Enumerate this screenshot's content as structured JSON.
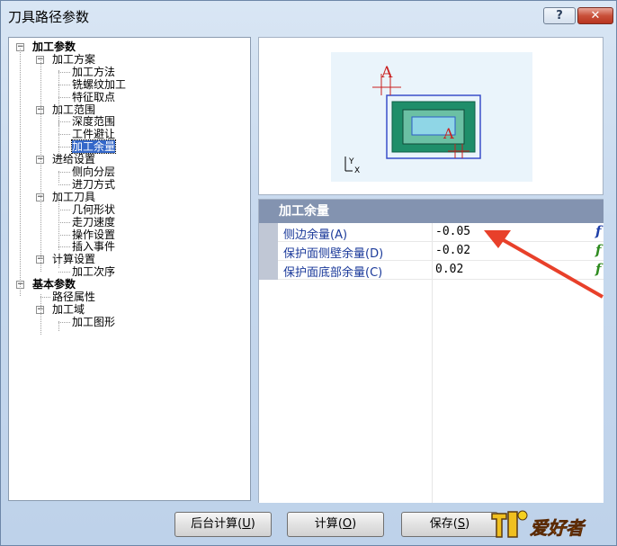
{
  "window": {
    "title": "刀具路径参数"
  },
  "titlebar": {
    "help_label": "?",
    "close_label": "✕"
  },
  "tree": {
    "items": [
      {
        "label": "加工参数",
        "bold": true,
        "selected": false
      },
      {
        "label": "加工方案",
        "bold": false,
        "selected": false
      },
      {
        "label": "加工方法",
        "bold": false,
        "selected": false
      },
      {
        "label": "铣螺纹加工",
        "bold": false,
        "selected": false
      },
      {
        "label": "特征取点",
        "bold": false,
        "selected": false
      },
      {
        "label": "加工范围",
        "bold": false,
        "selected": false
      },
      {
        "label": "深度范围",
        "bold": false,
        "selected": false
      },
      {
        "label": "工件避让",
        "bold": false,
        "selected": false
      },
      {
        "label": "加工余量",
        "bold": false,
        "selected": true
      },
      {
        "label": "进给设置",
        "bold": false,
        "selected": false
      },
      {
        "label": "侧向分层",
        "bold": false,
        "selected": false
      },
      {
        "label": "进刀方式",
        "bold": false,
        "selected": false
      },
      {
        "label": "加工刀具",
        "bold": false,
        "selected": false
      },
      {
        "label": "几何形状",
        "bold": false,
        "selected": false
      },
      {
        "label": "走刀速度",
        "bold": false,
        "selected": false
      },
      {
        "label": "操作设置",
        "bold": false,
        "selected": false
      },
      {
        "label": "插入事件",
        "bold": false,
        "selected": false
      },
      {
        "label": "计算设置",
        "bold": false,
        "selected": false
      },
      {
        "label": "加工次序",
        "bold": false,
        "selected": false
      },
      {
        "label": "基本参数",
        "bold": true,
        "selected": false
      },
      {
        "label": "路径属性",
        "bold": false,
        "selected": false
      },
      {
        "label": "加工域",
        "bold": false,
        "selected": false
      },
      {
        "label": "加工图形",
        "bold": false,
        "selected": false
      }
    ],
    "expand_symbol": "−"
  },
  "preview": {
    "label_top": "A",
    "label_inner": "A",
    "axis_y": "Y",
    "axis_x": "X"
  },
  "props": {
    "header": "加工余量",
    "rows": [
      {
        "name": "侧边余量(A)",
        "value": "-0.05",
        "fx": "f",
        "fx_color": "#1f3fa8"
      },
      {
        "name": "保护面侧壁余量(D)",
        "value": "-0.02",
        "fx": "f",
        "fx_color": "#2e8b1f"
      },
      {
        "name": "保护面底部余量(C)",
        "value": "0.02",
        "fx": "f",
        "fx_color": "#2e8b1f"
      }
    ]
  },
  "buttons": {
    "background_calc": {
      "text": "后台计算",
      "key": "U"
    },
    "calc": {
      "text": "计算",
      "key": "O"
    },
    "save": {
      "text": "保存",
      "key": "S"
    }
  },
  "watermark": {
    "text": "爱好者"
  },
  "colors": {
    "selection": "#3367c9",
    "header_bg": "#8393b0",
    "arrow": "#e8402a"
  }
}
